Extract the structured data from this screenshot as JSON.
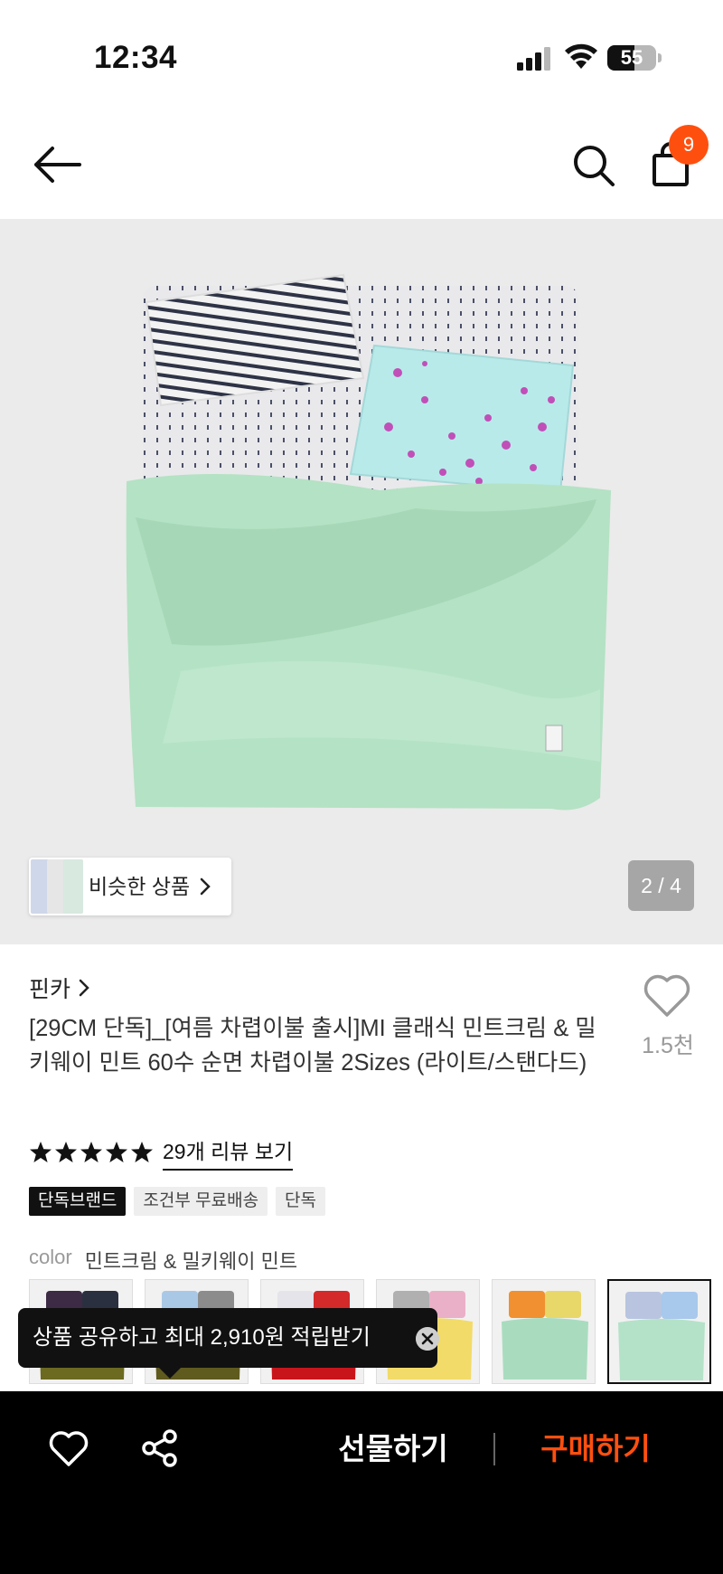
{
  "status_bar": {
    "time": "12:34",
    "battery": "55",
    "battery_level": 0.55,
    "icons": [
      "signal-icon",
      "wifi-icon",
      "battery-icon"
    ]
  },
  "header": {
    "icons": [
      "back-arrow-icon",
      "search-icon",
      "shopping-bag-icon"
    ],
    "cart_count": "9",
    "accent_color": "#ff4f0f"
  },
  "gallery": {
    "similar_label": "비슷한 상품",
    "page_counter": "2 / 4",
    "current_page": 2,
    "total_pages": 4
  },
  "product": {
    "brand": "핀카",
    "likes": "1.5천",
    "title": "[29CM 단독]_[여름 차렵이불 출시]MI 클래식 민트크림 & 밀키웨이 민트 60수 순면 차렵이불 2Sizes (라이트/스탠다드)",
    "rating": 5,
    "review_link": "29개 리뷰 보기",
    "tags": [
      "단독브랜드",
      "조건부 무료배송",
      "단독"
    ]
  },
  "color_option": {
    "key": "color",
    "value": "민트크림 & 밀키웨이 민트",
    "swatches": [
      {
        "name": "purple-olive",
        "colors": [
          "#3d2a45",
          "#2b3040",
          "#6b6a20"
        ]
      },
      {
        "name": "blue-olive",
        "colors": [
          "#a9c8e6",
          "#8c8c8c",
          "#5f5a1e"
        ]
      },
      {
        "name": "red",
        "colors": [
          "#e4e4ea",
          "#d42a2a",
          "#c8151b"
        ]
      },
      {
        "name": "lemon-pattern",
        "colors": [
          "#b0b0b0",
          "#eab0c8",
          "#f2db68"
        ]
      },
      {
        "name": "orange-mint",
        "colors": [
          "#f19030",
          "#e8d86a",
          "#a9dcbf"
        ]
      },
      {
        "name": "mint-cream",
        "colors": [
          "#b8c4e0",
          "#a8c8ec",
          "#b4e2c8"
        ],
        "selected": true
      }
    ]
  },
  "share_tooltip": {
    "text": "상품 공유하고 최대 2,910원 적립받기"
  },
  "bottom_bar": {
    "gift_label": "선물하기",
    "buy_label": "구매하기"
  }
}
